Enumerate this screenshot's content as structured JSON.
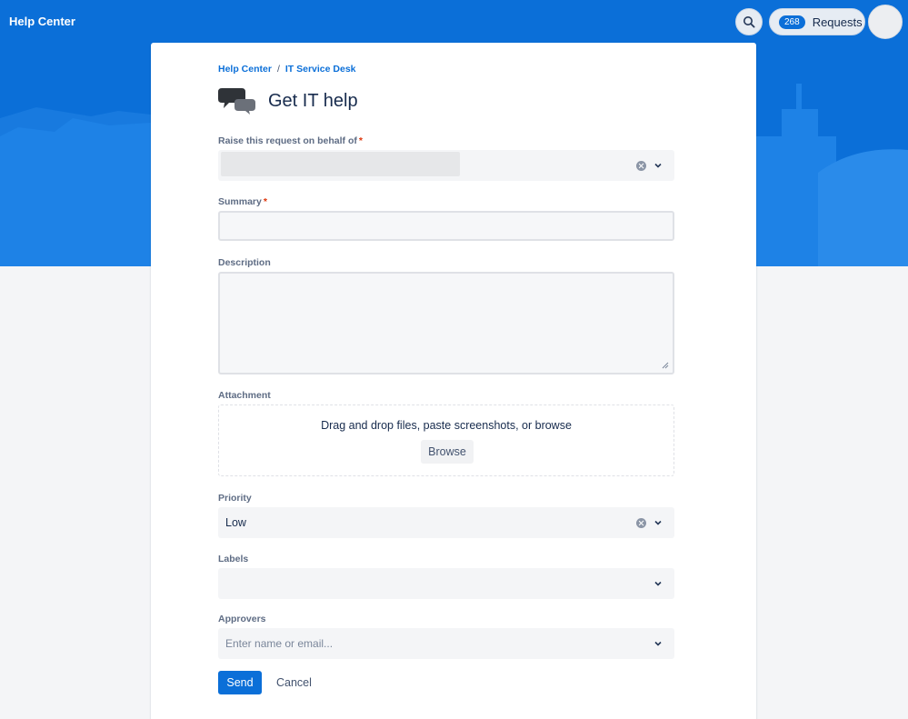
{
  "header": {
    "brand": "Help Center",
    "requests_count": "268",
    "requests_label": "Requests"
  },
  "breadcrumb": [
    "Help Center",
    "IT Service Desk"
  ],
  "page_title": "Get IT help",
  "form": {
    "on_behalf": {
      "label": "Raise this request on behalf of",
      "required_mark": "*"
    },
    "summary": {
      "label": "Summary",
      "required_mark": "*",
      "value": ""
    },
    "description": {
      "label": "Description",
      "value": ""
    },
    "attachment": {
      "label": "Attachment",
      "drop_text": "Drag and drop files, paste screenshots, or browse",
      "browse_label": "Browse"
    },
    "priority": {
      "label": "Priority",
      "value": "Low"
    },
    "labels": {
      "label": "Labels",
      "value": ""
    },
    "approvers": {
      "label": "Approvers",
      "placeholder": "Enter name or email..."
    },
    "send_label": "Send",
    "cancel_label": "Cancel"
  },
  "colors": {
    "accent": "#0b6fd8",
    "banner": "#0b6fd8",
    "required": "#de350b"
  },
  "icons": [
    "search-icon",
    "chat-bubbles-icon",
    "clear-icon",
    "chevron-down-icon",
    "resize-handle-icon"
  ]
}
